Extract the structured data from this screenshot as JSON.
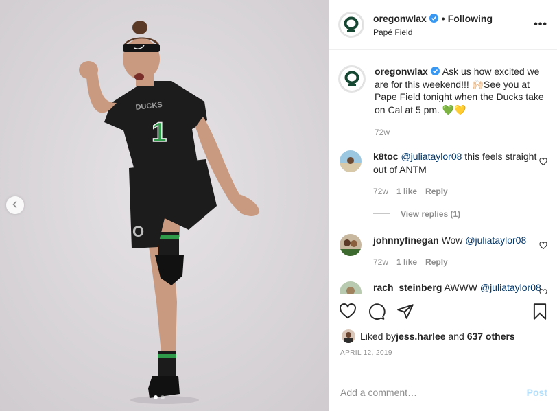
{
  "photo": {
    "background_color": "#dcd9dc",
    "jersey_team": "DUCKS",
    "jersey_number": "1",
    "shorts_logo": "O",
    "prev_icon": "chevron-left-icon",
    "slide_count": 2,
    "active_slide": 1
  },
  "header": {
    "username": "oregonwlax",
    "follow_status": "Following",
    "separator": "•",
    "location": "Papé Field",
    "more_icon": "more-horizontal-icon"
  },
  "caption": {
    "username": "oregonwlax",
    "text": "Ask us how excited we are for this weekend!!! 🙌🏻See you at Pape Field tonight when the Ducks take on Cal at 5 pm. 💚💛",
    "time": "72w"
  },
  "comments": [
    {
      "username": "k8toc",
      "mention": "@juliataylor08",
      "text": " this feels straight out of ANTM",
      "time": "72w",
      "likes": "1 like",
      "reply": "Reply",
      "view_replies": "View replies (1)"
    },
    {
      "username": "johnnyfinegan",
      "text": "Wow ",
      "mention": "@juliataylor08",
      "time": "72w",
      "likes": "1 like",
      "reply": "Reply"
    },
    {
      "username": "rach_steinberg",
      "text": "AWWW",
      "mention": "@juliataylor08"
    }
  ],
  "actions": {
    "like_icon": "heart-icon",
    "comment_icon": "comment-icon",
    "share_icon": "send-icon",
    "save_icon": "bookmark-icon"
  },
  "likes": {
    "prefix": "Liked by ",
    "user": "jess.harlee",
    "middle": " and ",
    "others": "637 others"
  },
  "date": "APRIL 12, 2019",
  "add_comment": {
    "placeholder": "Add a comment…",
    "post_label": "Post"
  },
  "colors": {
    "brand_green": "#154733",
    "brand_yellow": "#fee123",
    "verified_blue": "#3897f0",
    "mention_blue": "#00376b",
    "post_disabled": "#b2dffc"
  }
}
